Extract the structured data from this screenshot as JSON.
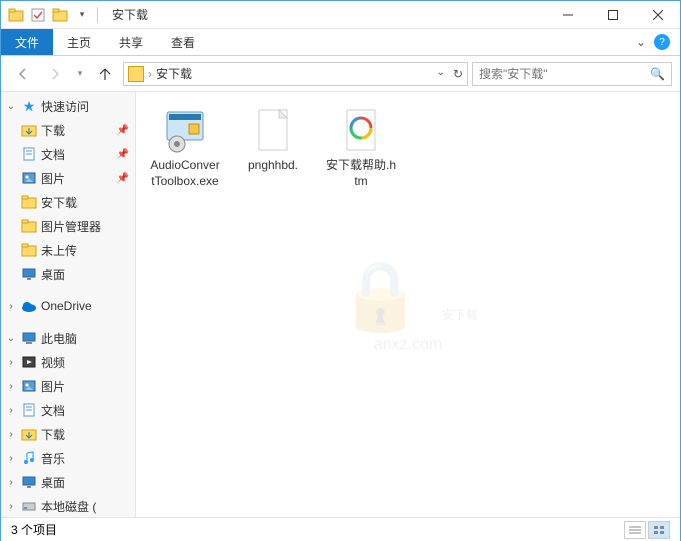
{
  "window": {
    "title": "安下载"
  },
  "ribbon": {
    "file": "文件",
    "tabs": [
      "主页",
      "共享",
      "查看"
    ]
  },
  "nav": {
    "path": "安下载",
    "search_placeholder": "搜索\"安下载\""
  },
  "sidebar": {
    "quick_access": "快速访问",
    "items": [
      {
        "label": "下载",
        "pinned": true,
        "icon": "download"
      },
      {
        "label": "文档",
        "pinned": true,
        "icon": "document"
      },
      {
        "label": "图片",
        "pinned": true,
        "icon": "picture"
      },
      {
        "label": "安下载",
        "pinned": false,
        "icon": "folder"
      },
      {
        "label": "图片管理器",
        "pinned": false,
        "icon": "folder"
      },
      {
        "label": "未上传",
        "pinned": false,
        "icon": "folder"
      },
      {
        "label": "桌面",
        "pinned": false,
        "icon": "desktop"
      }
    ],
    "onedrive": "OneDrive",
    "this_pc": "此电脑",
    "pc_items": [
      {
        "label": "视频",
        "icon": "video"
      },
      {
        "label": "图片",
        "icon": "picture"
      },
      {
        "label": "文档",
        "icon": "document"
      },
      {
        "label": "下载",
        "icon": "download"
      },
      {
        "label": "音乐",
        "icon": "music"
      },
      {
        "label": "桌面",
        "icon": "desktop"
      },
      {
        "label": "本地磁盘 (",
        "icon": "disk"
      }
    ]
  },
  "files": [
    {
      "name": "AudioConvertToolbox.exe",
      "type": "exe"
    },
    {
      "name": "pnghhbd.",
      "type": "file"
    },
    {
      "name": "安下载帮助.htm",
      "type": "htm"
    }
  ],
  "status": {
    "count": "3 个项目"
  },
  "watermark": {
    "text": "安下载",
    "url": "anxz.com"
  }
}
